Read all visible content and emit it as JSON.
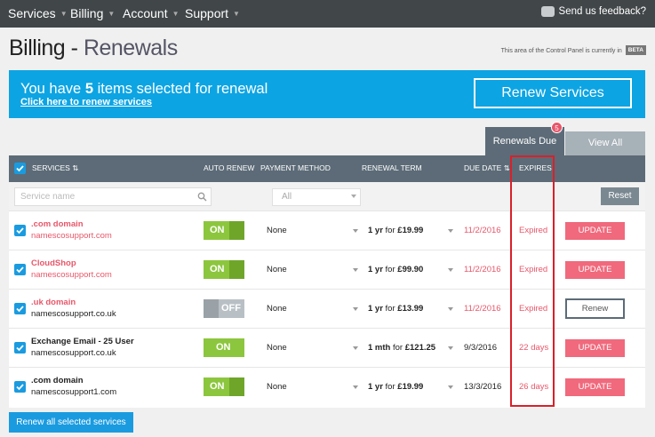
{
  "nav": {
    "items": [
      "Services",
      "Billing",
      "Account",
      "Support"
    ],
    "feedback": "Send us feedback?"
  },
  "page": {
    "title": "Billing",
    "separator": "-",
    "subtitle": "Renewals",
    "beta_note": "This area of the Control Panel is currently in",
    "beta_badge": "BETA"
  },
  "banner": {
    "prefix": "You have",
    "count": "5",
    "suffix": "items selected for renewal",
    "link": "Click here to renew services",
    "button": "Renew Services",
    "color": "#0da4e3"
  },
  "tabs": {
    "due_label": "Renewals Due",
    "due_count": "5",
    "all_label": "View All"
  },
  "table": {
    "headers": {
      "services": "Services",
      "auto_renew": "Auto Renew",
      "payment_method": "Payment Method",
      "renewal_term": "Renewal Term",
      "due_date": "Due Date",
      "expires": "Expires"
    },
    "sort_indicator": "⇅",
    "filters": {
      "search_placeholder": "Service name",
      "payment_filter": "All",
      "reset": "Reset"
    },
    "rows": [
      {
        "name": "CloudShop",
        "domain": "namescosupport.com",
        "toggle": "ON",
        "payment": "None",
        "term_prefix": "1 yr",
        "term_for": "for",
        "price": "£99.90",
        "due": "11/2/2016",
        "expires": "Expired",
        "action": "UPDATE"
      },
      {
        "name": ".uk domain",
        "domain": "namescosupport.co.uk",
        "toggle": "OFF",
        "payment": "None",
        "term_prefix": "1 yr",
        "term_for": "for",
        "price": "£13.99",
        "due": "11/2/2016",
        "expires": "Expired",
        "action": "Renew"
      },
      {
        "name": "Exchange Email - 25 User",
        "domain": "namescosupport.co.uk",
        "toggle": "ON",
        "payment": "None",
        "term_prefix": "1 mth",
        "term_for": "for",
        "price": "£121.25",
        "due": "9/3/2016",
        "expires": "22 days",
        "action": "UPDATE"
      },
      {
        "name": ".com domain",
        "domain": "namescosupport1.com",
        "toggle": "ON",
        "payment": "None",
        "term_prefix": "1 yr",
        "term_for": "for",
        "price": "£19.99",
        "due": "13/3/2016",
        "expires": "26 days",
        "action": "UPDATE"
      }
    ],
    "first_row": {
      "name": ".com domain",
      "domain": "namescosupport.com",
      "toggle": "ON",
      "payment": "None",
      "term_prefix": "1 yr",
      "term_for": "for",
      "price": "£19.99",
      "due": "11/2/2016",
      "expires": "Expired",
      "action": "UPDATE"
    }
  },
  "footer": {
    "renew_all": "Renew all selected services"
  },
  "colors": {
    "accent": "#1a9be0",
    "danger": "#e8576a",
    "toggle_on": "#8cc63e",
    "header": "#5c6b77"
  }
}
